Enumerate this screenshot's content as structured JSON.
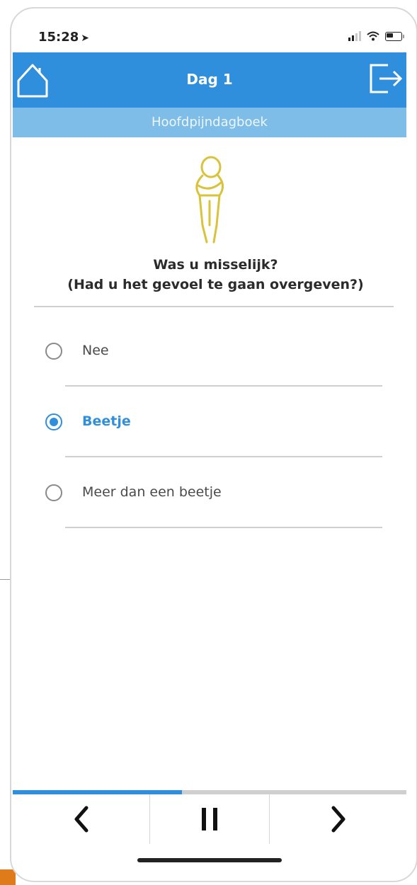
{
  "status_bar": {
    "time": "15:28",
    "location_glyph": "➤"
  },
  "header": {
    "title": "Dag 1",
    "subtitle": "Hoofdpijndagboek",
    "accent_color": "#2f8fdc",
    "left_icon": "home-icon",
    "right_icon": "exit-icon"
  },
  "question": {
    "illustration": "nauseous-person-icon",
    "line1": "Was u misselijk?",
    "line2": "(Had u het gevoel te gaan overgeven?)"
  },
  "options": [
    {
      "label": "Nee",
      "selected": false
    },
    {
      "label": "Beetje",
      "selected": true
    },
    {
      "label": "Meer dan een beetje",
      "selected": false
    }
  ],
  "progress": {
    "fraction": 0.43
  },
  "bottom_nav": {
    "prev_icon": "chevron-left-icon",
    "pause_icon": "pause-icon",
    "next_icon": "chevron-right-icon"
  }
}
